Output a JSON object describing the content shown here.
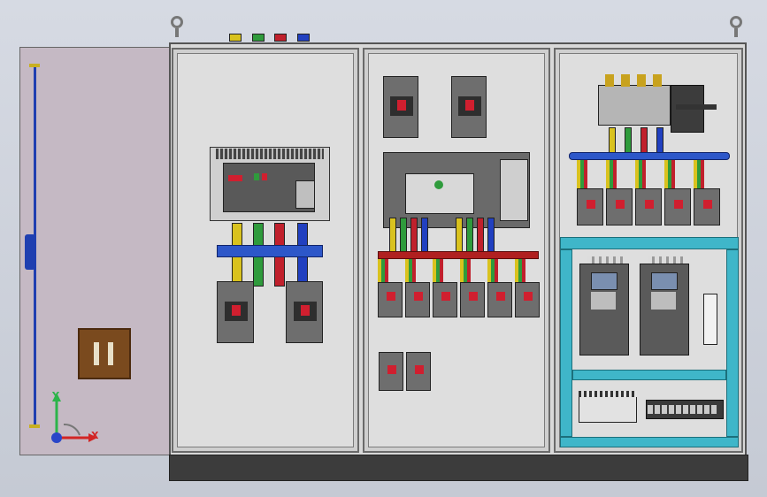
{
  "colors": {
    "door": "#c5b9c4",
    "cabinet": "#d9d9d9",
    "busbar_blue": "#2d57c9",
    "busbar_red": "#b02020",
    "phase_yellow": "#d9c21e",
    "phase_green": "#2f9b3c",
    "phase_red": "#c0202c",
    "neutral_blue": "#2140c0",
    "frame_cyan": "#3fb6c9",
    "plinth": "#3c3c3c"
  },
  "icons": {
    "lifting_eye": "lifting-eye-icon",
    "axis_triad": "xyz-axis-triad-icon"
  },
  "axis": {
    "x_label": "X",
    "y_label": "Y"
  }
}
